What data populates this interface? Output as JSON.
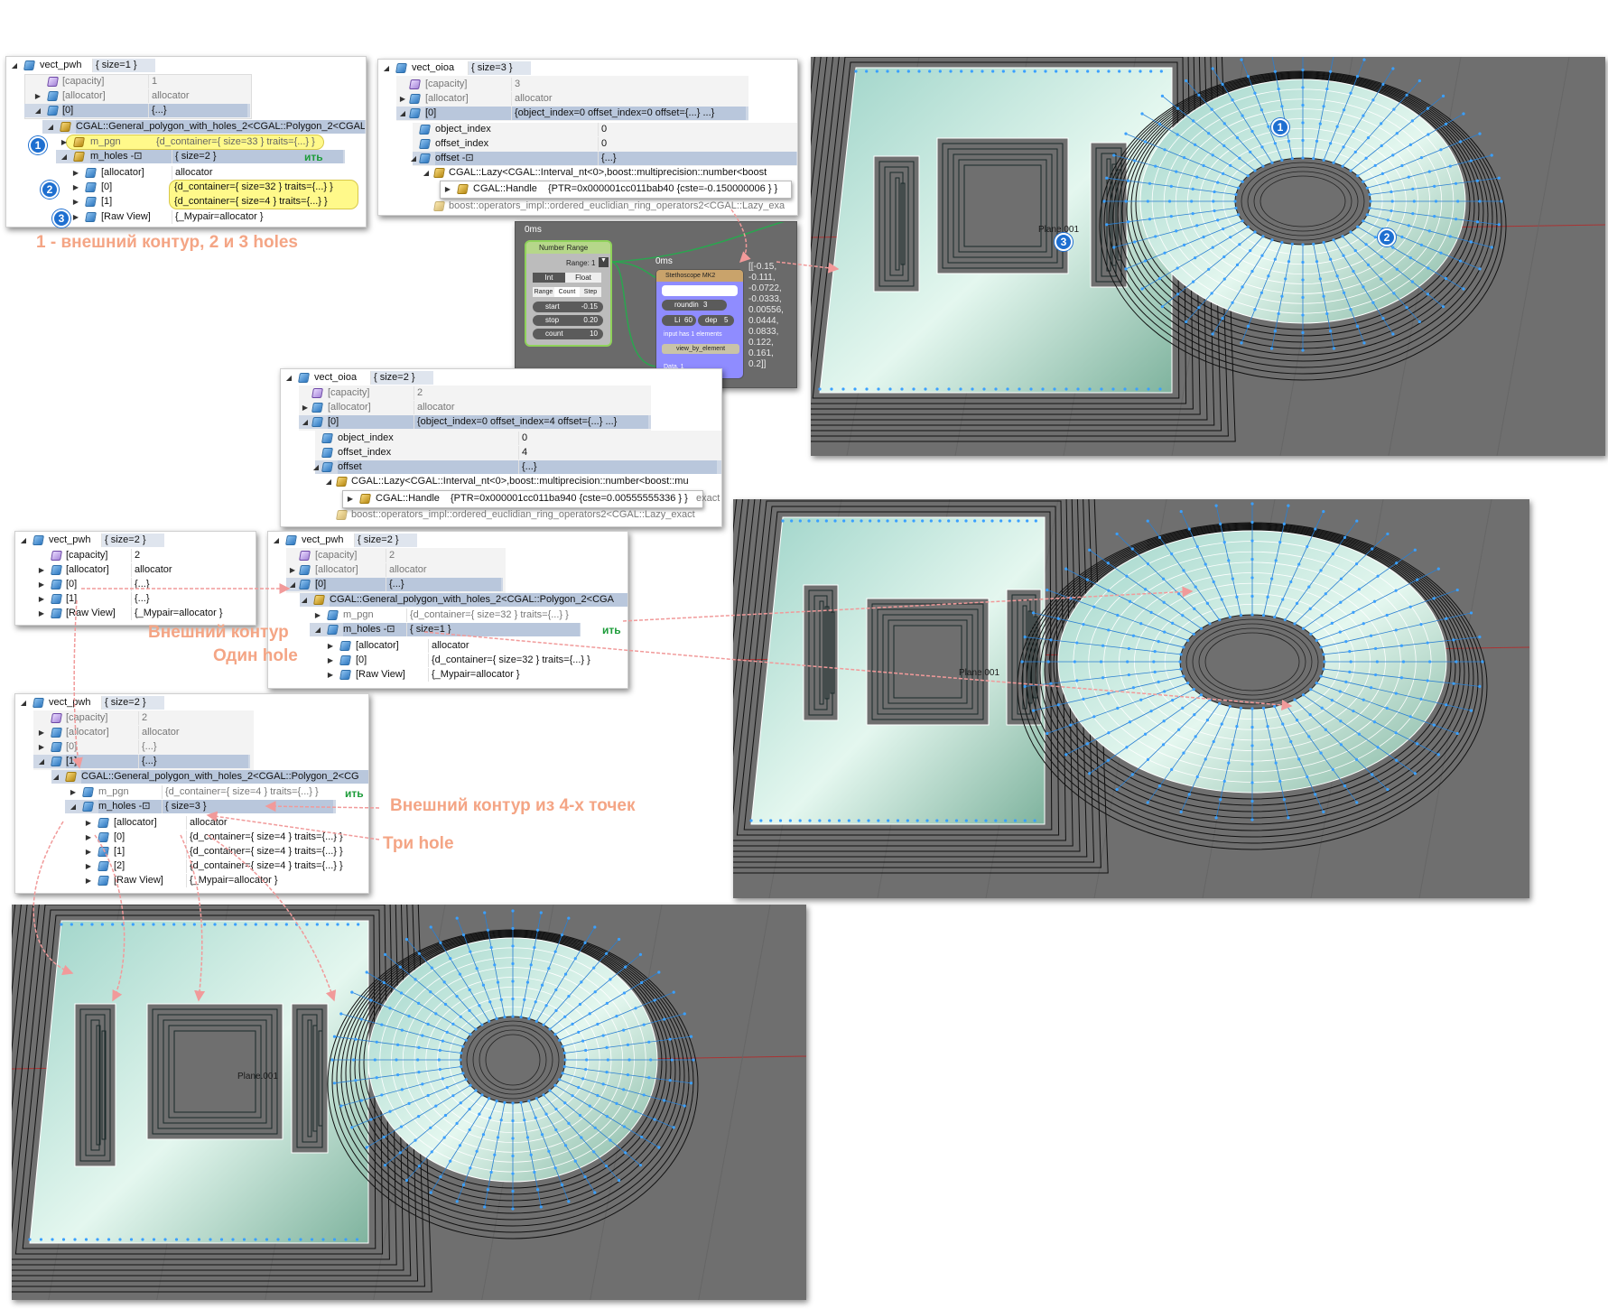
{
  "colors": {
    "annotation": "#f4a585",
    "badge": "#1e6fd0",
    "selected_row": "#b9c7dc",
    "highlight": "#fffb9c",
    "viewport_bg": "#6f6f6f",
    "node_range": "#b6d78a",
    "node_stethoscope": "#8f8cff",
    "vertex": "#3aa0ff"
  },
  "icons": [
    "debugger-variable-icon",
    "debugger-class-icon",
    "debugger-property-icon",
    "expand-triangle-icon",
    "numbered-badge-icon"
  ],
  "annotations": {
    "outer_holes": "1 - внешний контур, 2 и 3 holes",
    "outer_contour": "Внешний контур",
    "one_hole": "Один hole",
    "outer_4pts": "Внешний контур из 4-х точек",
    "three_holes": "Три hole"
  },
  "badges": [
    "1",
    "2",
    "3"
  ],
  "green_text": "ить",
  "plane_label": "Plane.001",
  "panel_a": {
    "rows": [
      {
        "name": "vect_pwh",
        "value": "{ size=1 }"
      },
      {
        "name": "[capacity]",
        "value": "1"
      },
      {
        "name": "[allocator]",
        "value": "allocator"
      },
      {
        "name": "[0]",
        "value": "{...}"
      },
      {
        "name": "CGAL::General_polygon_with_holes_2<CGAL::Polygon_2<CGAL",
        "value": ""
      },
      {
        "name": "m_pgn",
        "value": "{d_container={ size=33 } traits={...} }"
      },
      {
        "name": "m_holes -⊡",
        "value": "{ size=2 }"
      },
      {
        "name": "[allocator]",
        "value": "allocator"
      },
      {
        "name": "[0]",
        "value": "{d_container={ size=32 } traits={...} }"
      },
      {
        "name": "[1]",
        "value": "{d_container={ size=4 } traits={...} }"
      },
      {
        "name": "[Raw View]",
        "value": "{_Mypair=allocator }"
      }
    ]
  },
  "panel_b": {
    "rows": [
      {
        "name": "vect_oioa",
        "value": "{ size=3 }"
      },
      {
        "name": "[capacity]",
        "value": "3"
      },
      {
        "name": "[allocator]",
        "value": "allocator"
      },
      {
        "name": "[0]",
        "value": "{object_index=0 offset_index=0 offset={...} ...}"
      },
      {
        "name": "object_index",
        "value": "0"
      },
      {
        "name": "offset_index",
        "value": "0"
      },
      {
        "name": "offset -⊡",
        "value": "{...}"
      },
      {
        "name": "CGAL::Lazy<CGAL::Interval_nt<0>,boost::multiprecision::number<boost",
        "value": ""
      },
      {
        "name": "CGAL::Handle",
        "value": "{PTR=0x000001cc011bab40 {cste=-0.150000006 } }"
      },
      {
        "name": "boost::operators_impl::ordered_euclidian_ring_operators2<CGAL::Lazy_exa",
        "value": ""
      }
    ]
  },
  "panel_c": {
    "rows": [
      {
        "name": "vect_oioa",
        "value": "{ size=2 }"
      },
      {
        "name": "[capacity]",
        "value": "2"
      },
      {
        "name": "[allocator]",
        "value": "allocator"
      },
      {
        "name": "[0]",
        "value": "{object_index=0 offset_index=4 offset={...} ...}"
      },
      {
        "name": "object_index",
        "value": "0"
      },
      {
        "name": "offset_index",
        "value": "4"
      },
      {
        "name": "offset",
        "value": "{...}"
      },
      {
        "name": "CGAL::Lazy<CGAL::Interval_nt<0>,boost::multiprecision::number<boost::mu",
        "value": ""
      },
      {
        "name": "CGAL::Handle",
        "value": "{PTR=0x000001cc011ba940 {cste=0.00555555336 } }"
      },
      {
        "name": "boost::operators_impl::ordered_euclidian_ring_operators2<CGAL::Lazy_exact",
        "value": ""
      }
    ],
    "side": [
      "exact",
      "exact"
    ]
  },
  "panel_d": {
    "rows": [
      {
        "name": "vect_pwh",
        "value": "{ size=2 }"
      },
      {
        "name": "[capacity]",
        "value": "2"
      },
      {
        "name": "[allocator]",
        "value": "allocator"
      },
      {
        "name": "[0]",
        "value": "{...}"
      },
      {
        "name": "[1]",
        "value": "{...}"
      },
      {
        "name": "[Raw View]",
        "value": "{_Mypair=allocator }"
      }
    ]
  },
  "panel_e": {
    "rows": [
      {
        "name": "vect_pwh",
        "value": "{ size=2 }"
      },
      {
        "name": "[capacity]",
        "value": "2"
      },
      {
        "name": "[allocator]",
        "value": "allocator"
      },
      {
        "name": "[0]",
        "value": "{...}"
      },
      {
        "name": "CGAL::General_polygon_with_holes_2<CGAL::Polygon_2<CGA",
        "value": ""
      },
      {
        "name": "m_pgn",
        "value": "{d_container={ size=32 } traits={...} }"
      },
      {
        "name": "m_holes -⊡",
        "value": "{ size=1 }"
      },
      {
        "name": "[allocator]",
        "value": "allocator"
      },
      {
        "name": "[0]",
        "value": "{d_container={ size=32 } traits={...} }"
      },
      {
        "name": "[Raw View]",
        "value": "{_Mypair=allocator }"
      }
    ]
  },
  "panel_f": {
    "rows": [
      {
        "name": "vect_pwh",
        "value": "{ size=2 }"
      },
      {
        "name": "[capacity]",
        "value": "2"
      },
      {
        "name": "[allocator]",
        "value": "allocator"
      },
      {
        "name": "[0]",
        "value": "{...}"
      },
      {
        "name": "[1]",
        "value": "{...}"
      },
      {
        "name": "CGAL::General_polygon_with_holes_2<CGAL::Polygon_2<CG",
        "value": ""
      },
      {
        "name": "m_pgn",
        "value": "{d_container={ size=4 } traits={...} }"
      },
      {
        "name": "m_holes -⊡",
        "value": "{ size=3 }"
      },
      {
        "name": "[allocator]",
        "value": "allocator"
      },
      {
        "name": "[0]",
        "value": "{d_container={ size=4 } traits={...} }"
      },
      {
        "name": "[1]",
        "value": "{d_container={ size=4 } traits={...} }"
      },
      {
        "name": "[2]",
        "value": "{d_container={ size=4 } traits={...} }"
      },
      {
        "name": "[Raw View]",
        "value": "{_Mypair=allocator }"
      }
    ]
  },
  "node_editor": {
    "timing_1": "0ms",
    "timing_2": "0ms",
    "range_node": {
      "title": "Number Range",
      "mode": "Range: 1",
      "int": "Int",
      "float": "Float",
      "range": "Range",
      "count": "Count",
      "step": "Step",
      "start_label": "start",
      "start_value": "-0.15",
      "stop_label": "stop",
      "stop_value": "0.20",
      "count_label": "count",
      "count_value": "10"
    },
    "steth_node": {
      "title": "Stethoscope MK2",
      "roundin_label": "roundin",
      "roundin_value": "3",
      "li_label": "Li",
      "li_value": "60",
      "dep_label": "dep",
      "dep_value": "5",
      "info": "input has 1 elements",
      "button": "view_by_element",
      "socket": "Data. 1"
    },
    "output": [
      "[[-0.15,",
      "-0.111,",
      "-0.0722,",
      "-0.0333,",
      "0.00556,",
      "0.0444,",
      "0.0833,",
      "0.122,",
      "0.161,",
      "0.2]]"
    ]
  }
}
